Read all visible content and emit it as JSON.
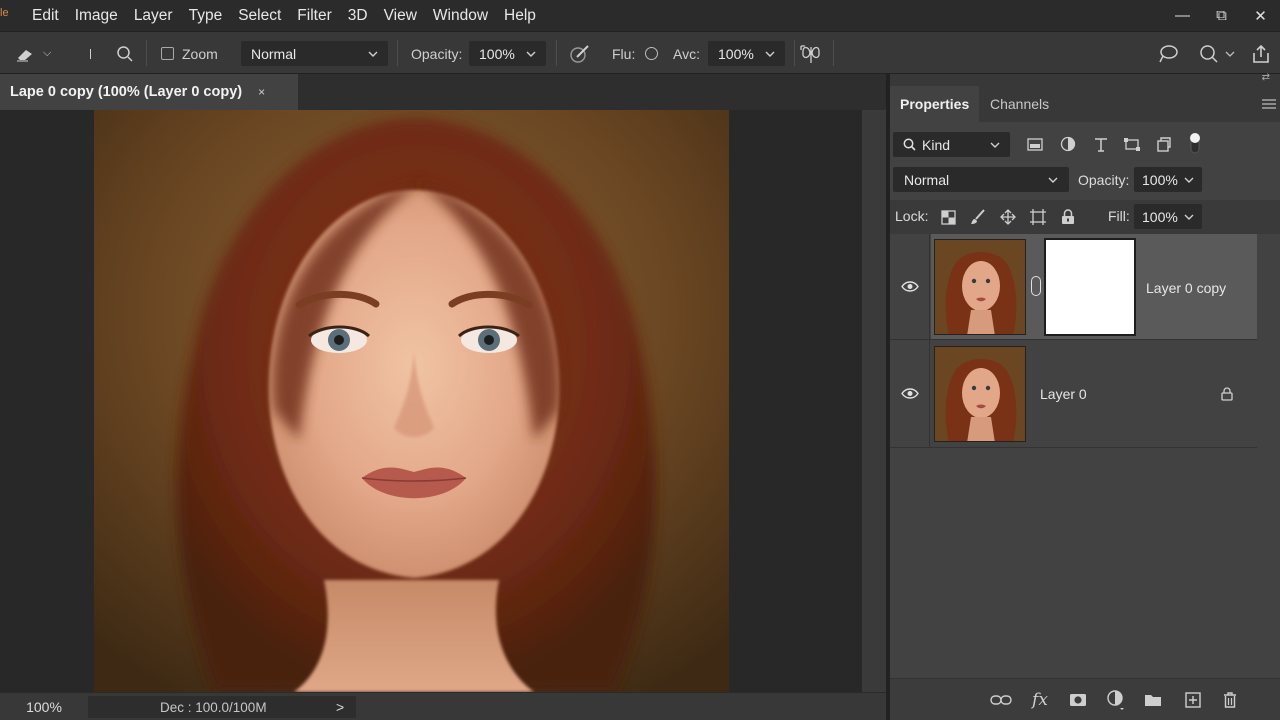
{
  "menubar": {
    "items": [
      "Edit",
      "Image",
      "Layer",
      "Type",
      "Select",
      "Filter",
      "3D",
      "View",
      "Window",
      "Help"
    ],
    "logo_text": "le"
  },
  "window_controls": {
    "minimize": "—",
    "restore": "⧉",
    "close": "✕"
  },
  "optionsbar": {
    "zoom_label": "Zoom",
    "blend_mode": "Normal",
    "opacity_label": "Opacity:",
    "opacity_value": "100%",
    "flow_label": "Flu:",
    "avc_label": "Avc:",
    "avc_value": "100%"
  },
  "document": {
    "tab_title": "Lape 0 copy (100% (Layer 0 copy)",
    "close_glyph": "×"
  },
  "statusbar": {
    "zoom": "100%",
    "doc_info": "Dec : 100.0/100M",
    "arrow": ">"
  },
  "panel": {
    "tabs": [
      "Properties",
      "Channels"
    ],
    "filter_kind": "Kind",
    "blend_mode": "Normal",
    "opacity_label": "Opacity:",
    "opacity_value": "100%",
    "lock_label": "Lock:",
    "fill_label": "Fill:",
    "fill_value": "100%",
    "layers": [
      {
        "name": "Layer 0 copy",
        "selected": true,
        "has_mask": true,
        "locked": false
      },
      {
        "name": "Layer 0",
        "selected": false,
        "has_mask": false,
        "locked": true
      }
    ]
  },
  "colors": {
    "background_dark": "#282828",
    "panel": "#424242",
    "selected_layer": "#5a5a5a",
    "hair": "#8a3a1a",
    "skin": "#e2a788"
  }
}
